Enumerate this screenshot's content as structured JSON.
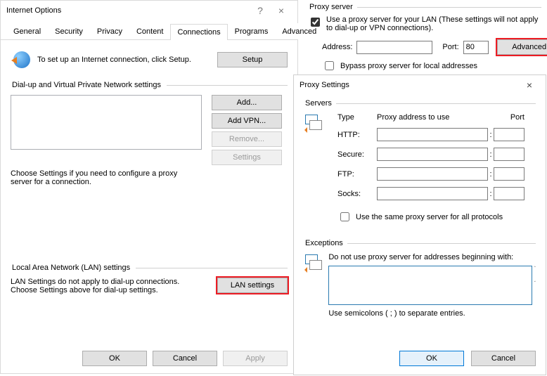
{
  "internet_options": {
    "title": "Internet Options",
    "help_glyph": "?",
    "close_glyph": "×",
    "tabs": [
      "General",
      "Security",
      "Privacy",
      "Content",
      "Connections",
      "Programs",
      "Advanced"
    ],
    "active_tab": "Connections",
    "setup_text": "To set up an Internet connection, click Setup.",
    "setup_btn": "Setup",
    "dialup_group": "Dial-up and Virtual Private Network settings",
    "add_btn": "Add...",
    "addvpn_btn": "Add VPN...",
    "remove_btn": "Remove...",
    "settings_btn": "Settings",
    "choose_settings_text": "Choose Settings if you need to configure a proxy server for a connection.",
    "lan_group": "Local Area Network (LAN) settings",
    "lan_text": "LAN Settings do not apply to dial-up connections. Choose Settings above for dial-up settings.",
    "lan_btn": "LAN settings",
    "ok": "OK",
    "cancel": "Cancel",
    "apply": "Apply"
  },
  "proxy_fragment": {
    "group": "Proxy server",
    "use_proxy_label": "Use a proxy server for your LAN (These settings will not apply to dial-up or VPN connections).",
    "address_label": "Address:",
    "address_value": "",
    "port_label": "Port:",
    "port_value": "80",
    "advanced_btn": "Advanced",
    "bypass_label": "Bypass proxy server for local addresses"
  },
  "proxy_settings": {
    "title": "Proxy Settings",
    "close_glyph": "×",
    "servers_group": "Servers",
    "col_type": "Type",
    "col_addr": "Proxy address to use",
    "col_port": "Port",
    "rows": {
      "http": {
        "label": "HTTP:",
        "addr": "",
        "port": ""
      },
      "secure": {
        "label": "Secure:",
        "addr": "",
        "port": ""
      },
      "ftp": {
        "label": "FTP:",
        "addr": "",
        "port": ""
      },
      "socks": {
        "label": "Socks:",
        "addr": "",
        "port": ""
      }
    },
    "same_proxy_label": "Use the same proxy server for all protocols",
    "exceptions_group": "Exceptions",
    "exceptions_text": "Do not use proxy server for addresses beginning with:",
    "exceptions_value": "",
    "semicolon_hint": "Use semicolons ( ; ) to separate entries.",
    "ok": "OK",
    "cancel": "Cancel"
  }
}
